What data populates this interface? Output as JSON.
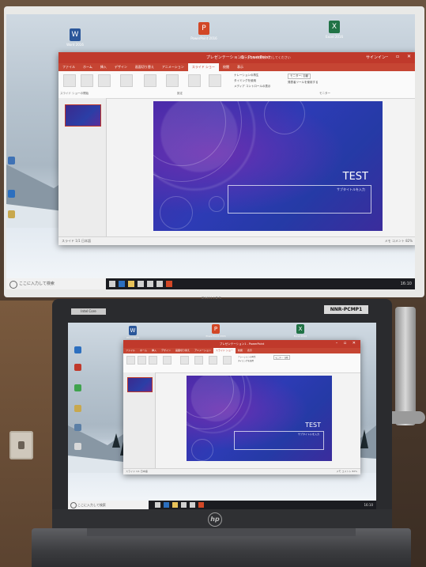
{
  "monitor": {
    "taskbar_search": "ここに入力して検索",
    "tray_time": "16:10",
    "brand_label": "PHILIPS"
  },
  "desktop_icons": [
    {
      "name": "Word 2016",
      "color": "#2b579a",
      "letter": "W"
    },
    {
      "name": "PowerPoint 2016",
      "color": "#d24726",
      "letter": "P"
    },
    {
      "name": "Excel 2016",
      "color": "#217346",
      "letter": "X"
    }
  ],
  "powerpoint": {
    "title": "プレゼンテーション1 - PowerPoint",
    "tell_me": "実行したい作業を入力してください",
    "sign_in": "サインイン",
    "tabs": [
      "ファイル",
      "ホーム",
      "挿入",
      "デザイン",
      "画面切り替え",
      "アニメーション",
      "スライド ショー",
      "校閲",
      "表示"
    ],
    "active_tab_index": 6,
    "ribbon_groups": [
      "スライド ショーの開始",
      "設定",
      "モニター"
    ],
    "ribbon_options": [
      "ナレーションの再生",
      "タイミングを使用",
      "メディア コントロールの表示",
      "発表者ツールを使用する"
    ],
    "monitor_select": "モニター: 自動",
    "status_left": "スライド 1/1  日本語",
    "status_right": "メモ  コメント  82%"
  },
  "slide": {
    "title": "TEST",
    "subtitle": "サブタイトルを入力"
  },
  "laptop": {
    "badge_left": "Intel Core",
    "badge_right": "NNR-PCMP1",
    "logo": "hp"
  },
  "colors": {
    "pp_red": "#c0392b",
    "taskbar": "#1b1c21",
    "slide_blue": "#2d3bb5"
  }
}
